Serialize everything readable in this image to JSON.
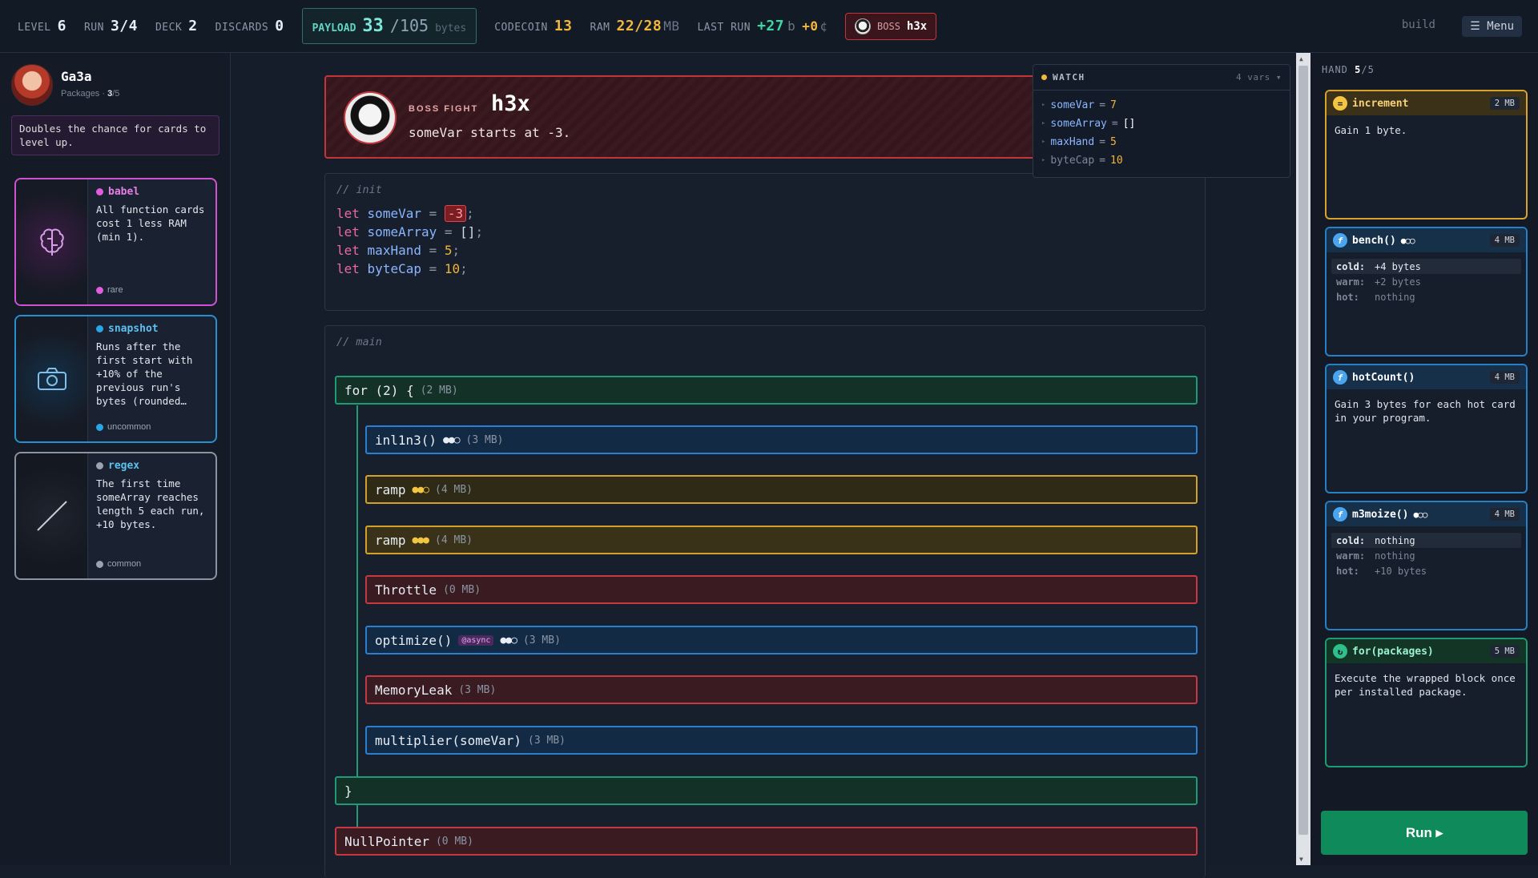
{
  "topbar": {
    "level_label": "LEVEL",
    "level": "6",
    "run_label": "RUN",
    "run": "3/4",
    "deck_label": "DECK",
    "deck": "2",
    "discards_label": "DISCARDS",
    "discards": "0",
    "payload_label": "PAYLOAD",
    "payload": "33",
    "payload_max": "/105",
    "payload_unit": "bytes",
    "codecoin_label": "CODECOIN",
    "codecoin": "13",
    "ram_label": "RAM",
    "ram": "22/28",
    "ram_unit": "MB",
    "last_run_label": "LAST RUN",
    "last_run_bytes": "+27",
    "last_run_bytes_unit": "b",
    "last_run_coin": "+0",
    "last_run_coin_unit": "¢",
    "boss_label": "BOSS",
    "boss_name": "h3x",
    "build_label": "build",
    "menu_label": "☰ Menu"
  },
  "profile": {
    "name": "Ga3a",
    "packages_label": "Packages ·",
    "packages_count": "3",
    "packages_max": "/5",
    "description": "Doubles the chance for cards to level up."
  },
  "packages": [
    {
      "name": "babel",
      "text": "All function cards cost 1 less RAM (min 1).",
      "rarity": "rare",
      "color": "#e25ce0",
      "icon": "brain-icon"
    },
    {
      "name": "snapshot",
      "text": "Runs after the first start with +10% of the previous run's bytes (rounded…",
      "rarity": "uncommon",
      "color": "#2aa6e8",
      "icon": "camera-icon"
    },
    {
      "name": "regex",
      "text": "The first time someArray reaches length 5 each run, +10 bytes.",
      "rarity": "common",
      "color": "#9aa3b0",
      "icon": "slash-icon"
    }
  ],
  "boss": {
    "label": "BOSS FIGHT",
    "name": "h3x",
    "description": "someVar starts at -3."
  },
  "init": {
    "comment": "// init",
    "lines": [
      {
        "kw": "let",
        "name": "someVar",
        "op": "=",
        "value": "-3",
        "end": ";"
      },
      {
        "kw": "let",
        "name": "someArray",
        "op": "=",
        "value": "[]",
        "end": ";"
      },
      {
        "kw": "let",
        "name": "maxHand",
        "op": "=",
        "value": "5",
        "end": ";"
      },
      {
        "kw": "let",
        "name": "byteCap",
        "op": "=",
        "value": "10",
        "end": ";"
      }
    ]
  },
  "main": {
    "comment": "// main",
    "for_label": "for (2) {",
    "for_mb": "(2 MB)",
    "close": "}",
    "blocks": [
      {
        "label": "inl1n3()",
        "dots": "●●○",
        "mb": "(3 MB)"
      },
      {
        "label": "ramp",
        "dots": "●●○",
        "mb": "(4 MB)"
      },
      {
        "label": "ramp",
        "dots": "●●●",
        "mb": "(4 MB)"
      },
      {
        "label": "Throttle",
        "mb": "(0 MB)"
      },
      {
        "label": "optimize()",
        "tag": "@async",
        "dots": "●●○",
        "mb": "(3 MB)"
      },
      {
        "label": "MemoryLeak",
        "mb": "(3 MB)"
      },
      {
        "label": "multiplier(someVar)",
        "mb": "(3 MB)"
      }
    ],
    "after": {
      "label": "NullPointer",
      "mb": "(0 MB)"
    }
  },
  "watch": {
    "title": "WATCH",
    "count": "4 vars ▾",
    "vars": [
      {
        "name": "someVar",
        "value": "7"
      },
      {
        "name": "someArray",
        "value": "[]"
      },
      {
        "name": "maxHand",
        "value": "5"
      },
      {
        "name": "byteCap",
        "value": "10"
      }
    ]
  },
  "hand": {
    "label": "HAND",
    "count": "5",
    "max": "/5",
    "cards": [
      {
        "name": "increment",
        "mb": "2 MB",
        "icon": "=",
        "text": "Gain 1 byte."
      },
      {
        "name": "bench()",
        "dots": "●○○",
        "mb": "4 MB",
        "icon": "f",
        "tiers": [
          [
            "cold:",
            "+4 bytes"
          ],
          [
            "warm:",
            "+2 bytes"
          ],
          [
            "hot:",
            "nothing"
          ]
        ]
      },
      {
        "name": "hotCount()",
        "mb": "4 MB",
        "icon": "f",
        "text": "Gain 3 bytes for each hot card in your program."
      },
      {
        "name": "m3moize()",
        "dots": "●○○",
        "mb": "4 MB",
        "icon": "f",
        "tiers": [
          [
            "cold:",
            "nothing"
          ],
          [
            "warm:",
            "nothing"
          ],
          [
            "hot:",
            "+10 bytes"
          ]
        ]
      },
      {
        "name": "for(packages)",
        "mb": "5 MB",
        "icon": "↻",
        "text": "Execute the wrapped block once per installed package."
      }
    ],
    "run_label": "Run ▸"
  }
}
